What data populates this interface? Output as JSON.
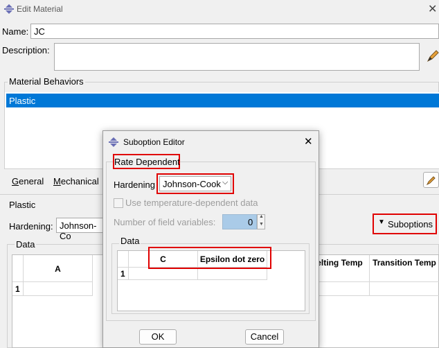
{
  "window": {
    "title": "Edit Material"
  },
  "name_label": "Name:",
  "name_value": "JC",
  "description_label": "Description:",
  "behaviors": {
    "label": "Material Behaviors",
    "selected_item": "Plastic"
  },
  "menus": [
    {
      "label": "General",
      "key": "G"
    },
    {
      "label": "Mechanical",
      "key": "M"
    }
  ],
  "plastic": {
    "label": "Plastic",
    "hardening_label": "Hardening:",
    "hardening_value": "Johnson-Co",
    "suboptions_label": "Suboptions"
  },
  "data_section": {
    "label": "Data",
    "columns": [
      "A",
      "Melting Temp",
      "Transition Temp"
    ],
    "row_number": "1"
  },
  "suboption_dialog": {
    "title": "Suboption Editor",
    "rate_dependent_label": "Rate Dependent",
    "hardening_label": "Hardening",
    "hardening_value": "Johnson-Cook",
    "temp_checkbox_label": "Use temperature-dependent data",
    "field_vars_label": "Number of field variables:",
    "field_vars_value": "0",
    "data_label": "Data",
    "columns": [
      "C",
      "Epsilon dot zero"
    ],
    "row_number": "1",
    "ok_label": "OK",
    "cancel_label": "Cancel"
  }
}
